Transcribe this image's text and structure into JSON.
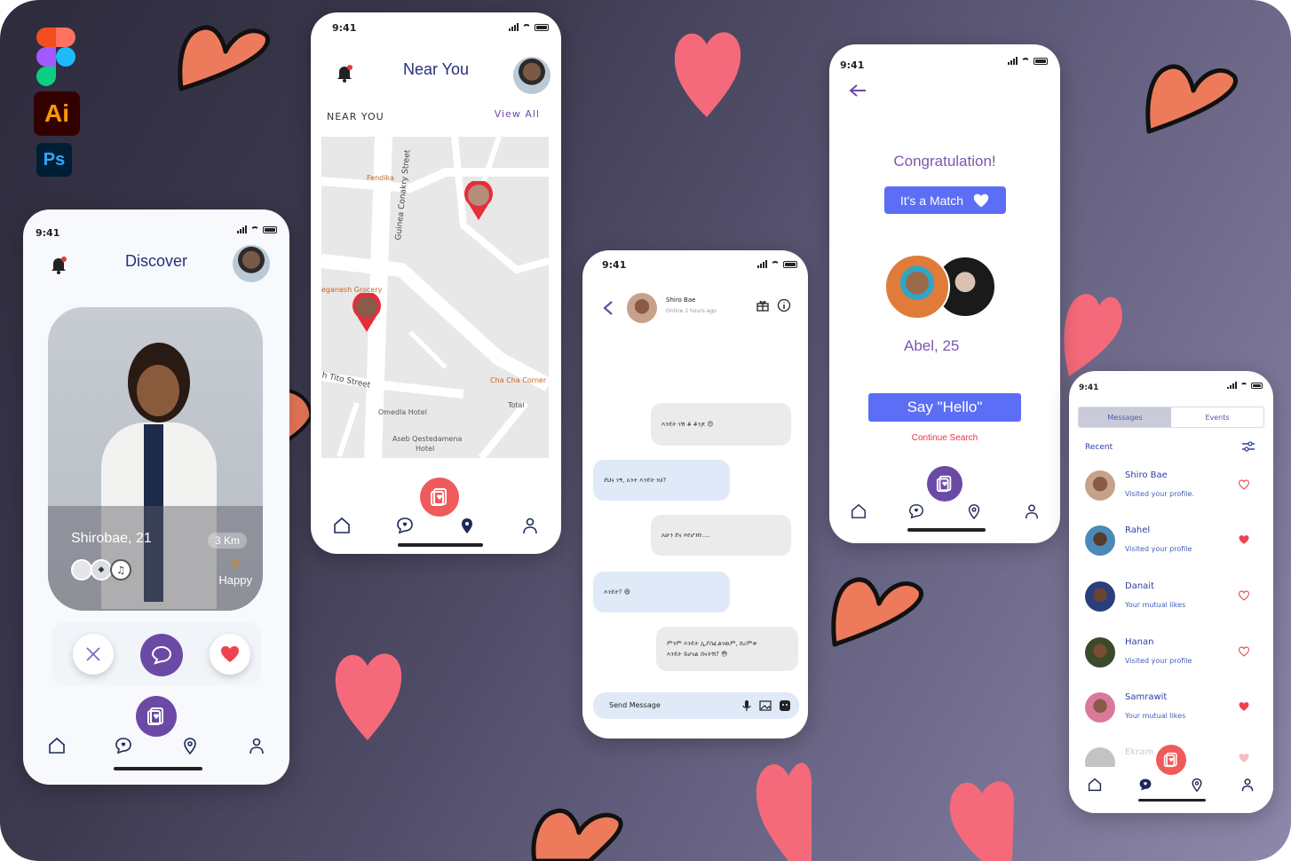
{
  "tools": {
    "ai_label": "Ai",
    "ps_label": "Ps"
  },
  "status": {
    "time": "9:41"
  },
  "discover": {
    "title": "Discover",
    "profile_name": "Shirobae, 21",
    "distance": "3 Km",
    "mood": "Happy"
  },
  "near_you": {
    "title": "Near You",
    "section_label": "NEAR YOU",
    "view_all": "View All",
    "map_labels": {
      "fendika": "Fendika",
      "street1": "Guinea Conakry Street",
      "grocery": "eganesh Grocery",
      "tito": "h Tito Street",
      "chacha": "Cha Cha Corner",
      "total": "Total",
      "omedla": "Omedla Hotel",
      "aseb": "Aseb Qestedamena",
      "hotel": "Hotel"
    }
  },
  "chat": {
    "contact_name": "Shiro Bae",
    "contact_status": "Online 2 hours ago",
    "messages": [
      {
        "text": "እንዴት ነሽ ቆ ቆንጆ 😍"
      },
      {
        "text": "ደህና ነኝ, አንተ እንዴት ነህ?"
      },
      {
        "text": "አሁን ደና እየሆንኩ...."
      },
      {
        "text": "እንዴት? 😄"
      },
      {
        "text": "ምንም እንዴት ኢያስፈልገዉም, ከረምቱ"
      },
      {
        "text": "እንዴት ይሆናል በናትሽ? 😳"
      }
    ],
    "input_placeholder": "Send Message"
  },
  "match": {
    "congrats": "Congratulation!",
    "badge": "It's a Match",
    "name": "Abel, 25",
    "cta": "Say \"Hello\"",
    "continue": "Continue Search"
  },
  "messages": {
    "tab_messages": "Messages",
    "tab_events": "Events",
    "recent": "Recent",
    "items": [
      {
        "name": "Shiro Bae",
        "sub": "Visited your profile.",
        "liked": false
      },
      {
        "name": "Rahel",
        "sub": "Visited your profile",
        "liked": true
      },
      {
        "name": "Danait",
        "sub": "Your mutual likes",
        "liked": false
      },
      {
        "name": "Hanan",
        "sub": "Visited your profile",
        "liked": false
      },
      {
        "name": "Samrawit",
        "sub": "Your mutual likes",
        "liked": true
      },
      {
        "name": "Ekram",
        "sub": "",
        "liked": true
      }
    ]
  },
  "colors": {
    "accent_purple": "#6b4aa6",
    "accent_blue": "#5b6ef5",
    "heart_red": "#ef5a5a",
    "title_navy": "#25307a"
  }
}
